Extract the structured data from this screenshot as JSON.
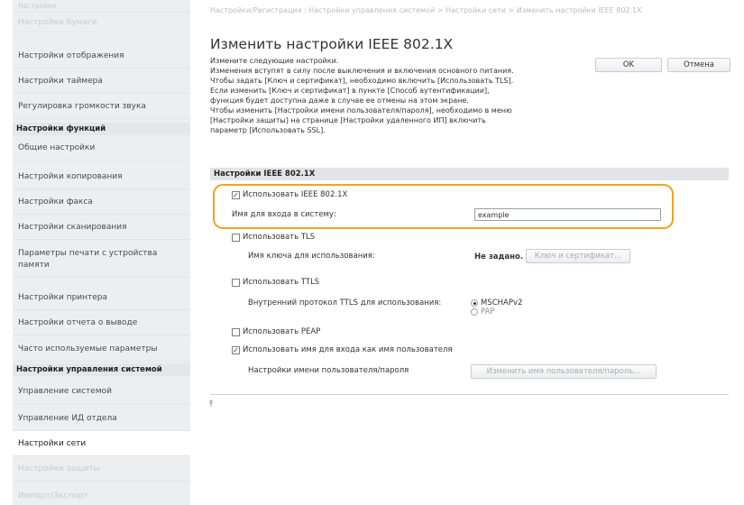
{
  "sidebar": {
    "items": [
      {
        "label": "Настройки",
        "style": "faded"
      },
      {
        "label": "Настройки бумаги",
        "style": "faded"
      },
      {
        "label": "Настройки отображения",
        "style": "normal"
      },
      {
        "label": "Настройки таймера",
        "style": "normal"
      },
      {
        "label": "Регулировка громкости звука",
        "style": "normal"
      }
    ],
    "section1": "Настройки функций",
    "items2": [
      {
        "label": "Общие настройки"
      },
      {
        "label": "Настройки копирования"
      },
      {
        "label": "Настройки факса"
      },
      {
        "label": "Настройки сканирования"
      },
      {
        "label": "Параметры печати с устройства памяти"
      },
      {
        "label": "Настройки принтера"
      },
      {
        "label": "Настройки отчета о выводе"
      },
      {
        "label": "Часто используемые параметры"
      }
    ],
    "section2": "Настройки управления системой",
    "items3": [
      {
        "label": "Управление системой"
      },
      {
        "label": "Управление ИД отдела"
      },
      {
        "label": "Настройки сети",
        "style": "selected"
      },
      {
        "label": "Настройки защиты",
        "style": "faded"
      },
      {
        "label": "Импорт/Экспорт",
        "style": "faded"
      }
    ]
  },
  "header": {
    "breadcrumb": "Настройки/Регистрация : Настройки управления системой > Настройки сети > Изменить настройки IEEE 802.1X",
    "title": "Изменить настройки IEEE 802.1X",
    "ok_label": "OK",
    "cancel_label": "Отмена"
  },
  "description": [
    "Измените следующие настройки.",
    "Изменения вступят в силу после выключения и включения основного питания.",
    "Чтобы задать [Ключ и сертификат], необходимо включить [Использовать TLS].",
    "Если изменить [Ключ и сертификат] в пункте [Способ аутентификации],",
    "функция будет доступна даже в случае ее отмены на этом экране.",
    "Чтобы изменить [Настройки имени пользователя/пароля], необходимо в меню",
    "[Настройки защиты] на странице [Настройки удаленного ИП] включить",
    "параметр [Использовать SSL]."
  ],
  "section": {
    "title": "Настройки IEEE 802.1X",
    "use_ieee_label": "Использовать IEEE 802.1X",
    "use_ieee_checked": true,
    "login_name_label": "Имя для входа в систему:",
    "login_name_value": "example",
    "use_tls_label": "Использовать TLS",
    "use_tls_checked": false,
    "key_name_label": "Имя ключа для использования:",
    "key_name_value": "Не задано.",
    "key_cert_button": "Ключ и сертификат...",
    "use_ttls_label": "Использовать TTLS",
    "use_ttls_checked": false,
    "ttls_protocol_label": "Внутренний протокол TTLS для использования:",
    "ttls_options": [
      "MSCHAPv2",
      "PAP"
    ],
    "ttls_selected": "MSCHAPv2",
    "use_peap_label": "Использовать PEAP",
    "use_peap_checked": false,
    "use_login_as_user_label": "Использовать имя для входа как имя пользователя",
    "use_login_as_user_checked": true,
    "user_pass_label": "Настройки имени пользователя/пароля",
    "user_pass_button": "Изменить имя пользователя/пароль..."
  },
  "colors": {
    "highlight": "#f2a11f",
    "sidebar_bg": "#eceef0",
    "section_bg": "#e2e4e7"
  }
}
